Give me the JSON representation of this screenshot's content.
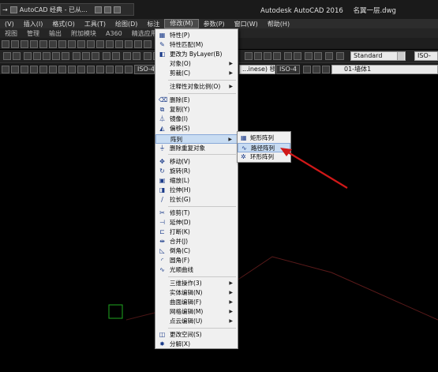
{
  "window": {
    "qat_label": "AutoCAD 经典 - 已从...",
    "app_name": "Autodesk AutoCAD 2016",
    "file_name": "名翼一层.dwg"
  },
  "menubar": [
    "(V)",
    "插入(I)",
    "格式(O)",
    "工具(T)",
    "绘图(D)",
    "标注",
    "修改(M)",
    "参数(P)",
    "窗口(W)",
    "帮助(H)"
  ],
  "ribbon_tabs": [
    "视图",
    "管理",
    "输出",
    "附加模块",
    "A360",
    "精选应用",
    "BIM 3"
  ],
  "toolbar": {
    "text_style": "Standard",
    "dim_style": "ISO-",
    "iso_left": "ISO-4",
    "linetype": "...inese) 移置",
    "iso_mid": "ISO-4",
    "layer": "01-墙体1"
  },
  "modify_menu": {
    "items": [
      {
        "label": "特性(P)",
        "icon": "▦"
      },
      {
        "label": "特性匹配(M)",
        "icon": "✎"
      },
      {
        "label": "更改为 ByLayer(B)",
        "icon": "◧"
      },
      {
        "label": "对象(O)",
        "icon": "",
        "sub": true
      },
      {
        "label": "剪裁(C)",
        "icon": "",
        "sub": true
      },
      {
        "label": "注释性对象比例(O)",
        "icon": "",
        "sub": true
      },
      {
        "label": "删除(E)",
        "icon": "⌫"
      },
      {
        "label": "复制(Y)",
        "icon": "⧉"
      },
      {
        "label": "镜像(I)",
        "icon": "⏃"
      },
      {
        "label": "偏移(S)",
        "icon": "◭"
      },
      {
        "label": "阵列",
        "icon": "",
        "sub": true
      },
      {
        "label": "删除重复对象",
        "icon": "⏚"
      },
      {
        "label": "移动(V)",
        "icon": "✥"
      },
      {
        "label": "旋转(R)",
        "icon": "↻"
      },
      {
        "label": "缩放(L)",
        "icon": "▣"
      },
      {
        "label": "拉伸(H)",
        "icon": "◨"
      },
      {
        "label": "拉长(G)",
        "icon": "∕"
      },
      {
        "label": "修剪(T)",
        "icon": "✂"
      },
      {
        "label": "延伸(D)",
        "icon": "⊣"
      },
      {
        "label": "打断(K)",
        "icon": "⊏"
      },
      {
        "label": "合并(J)",
        "icon": "⇹"
      },
      {
        "label": "倒角(C)",
        "icon": "◺"
      },
      {
        "label": "圆角(F)",
        "icon": "◜"
      },
      {
        "label": "光顺曲线",
        "icon": "∿"
      },
      {
        "label": "三维操作(3)",
        "icon": "",
        "sub": true
      },
      {
        "label": "实体编辑(N)",
        "icon": "",
        "sub": true
      },
      {
        "label": "曲面编辑(F)",
        "icon": "",
        "sub": true
      },
      {
        "label": "网格编辑(M)",
        "icon": "",
        "sub": true
      },
      {
        "label": "点云编辑(U)",
        "icon": "",
        "sub": true
      },
      {
        "label": "更改空间(S)",
        "icon": "◫"
      },
      {
        "label": "分解(X)",
        "icon": "✸"
      }
    ]
  },
  "array_submenu": {
    "items": [
      {
        "label": "矩形阵列",
        "icon": "▦"
      },
      {
        "label": "路径阵列",
        "icon": "∿"
      },
      {
        "label": "环形阵列",
        "icon": "✲"
      }
    ]
  },
  "colors": {
    "highlight": "#c8dcf2",
    "menu_bg": "#f0f0f0",
    "arrow": "#d01818",
    "canvas": "#000000"
  }
}
